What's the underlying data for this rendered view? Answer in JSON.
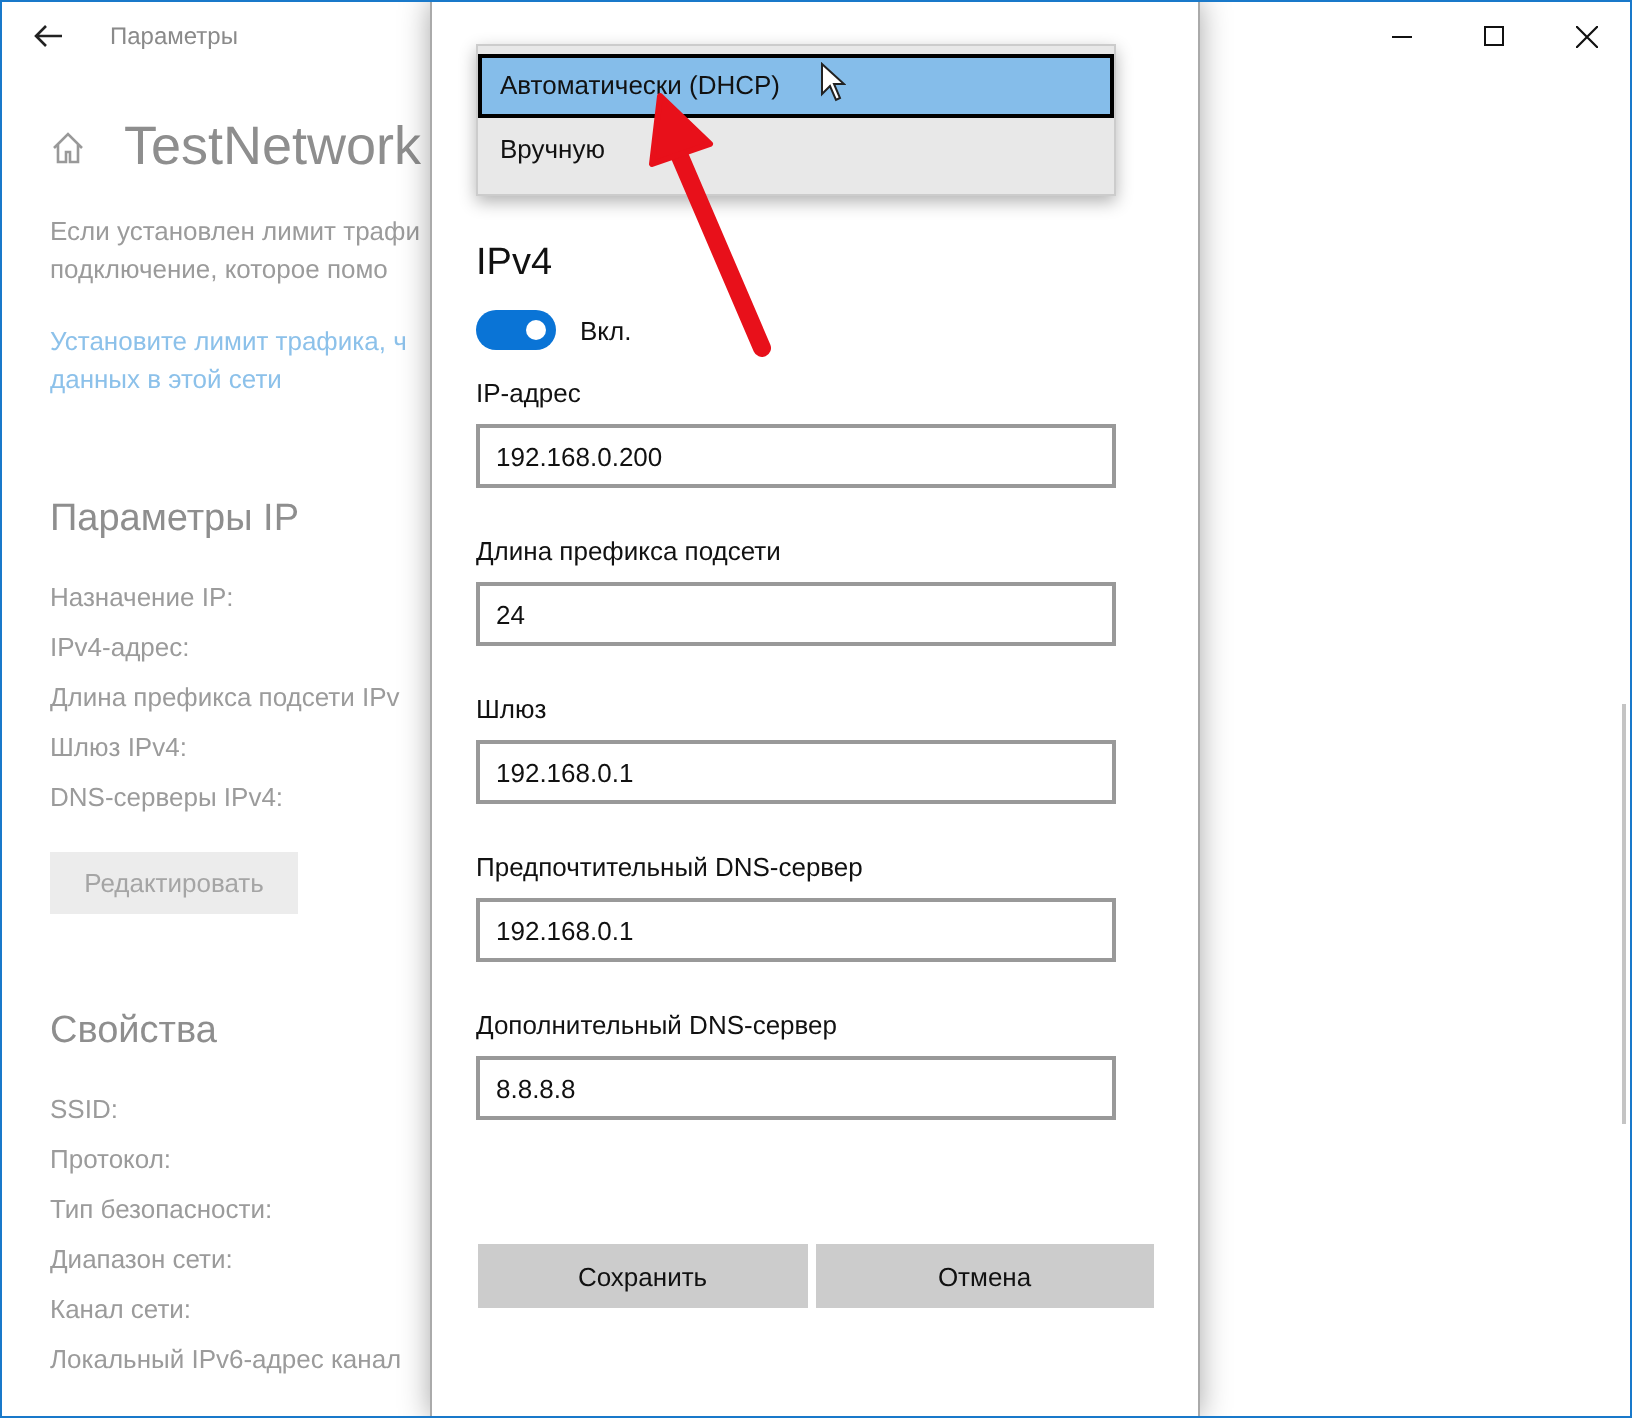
{
  "window": {
    "title": "Параметры"
  },
  "page": {
    "title": "TestNetwork",
    "description_lines": [
      "Если установлен лимит трафи",
      "подключение, которое помо"
    ],
    "link_lines": [
      "Установите лимит трафика, ч",
      "данных в этой сети"
    ]
  },
  "ip_settings": {
    "title": "Параметры IP",
    "fields": [
      "Назначение IP:",
      "IPv4-адрес:",
      "Длина префикса подсети IPv",
      "Шлюз IPv4:",
      "DNS-серверы IPv4:"
    ],
    "edit_button": "Редактировать"
  },
  "properties": {
    "title": "Свойства",
    "fields": [
      "SSID:",
      "Протокол:",
      "Тип безопасности:",
      "Диапазон сети:",
      "Канал сети:",
      "Локальный IPv6-адрес канал"
    ]
  },
  "dialog": {
    "dropdown": {
      "options": [
        {
          "label": "Автоматически (DHCP)",
          "selected": true
        },
        {
          "label": "Вручную",
          "selected": false
        }
      ]
    },
    "ipv4": {
      "title": "IPv4",
      "toggle": {
        "on": true,
        "label": "Вкл."
      }
    },
    "fields": [
      {
        "label": "IP-адрес",
        "value": "192.168.0.200"
      },
      {
        "label": "Длина префикса подсети",
        "value": "24"
      },
      {
        "label": "Шлюз",
        "value": "192.168.0.1"
      },
      {
        "label": "Предпочтительный DNS-сервер",
        "value": "192.168.0.1"
      },
      {
        "label": "Дополнительный DNS-сервер",
        "value": "8.8.8.8"
      }
    ],
    "buttons": [
      "Сохранить",
      "Отмена"
    ]
  }
}
